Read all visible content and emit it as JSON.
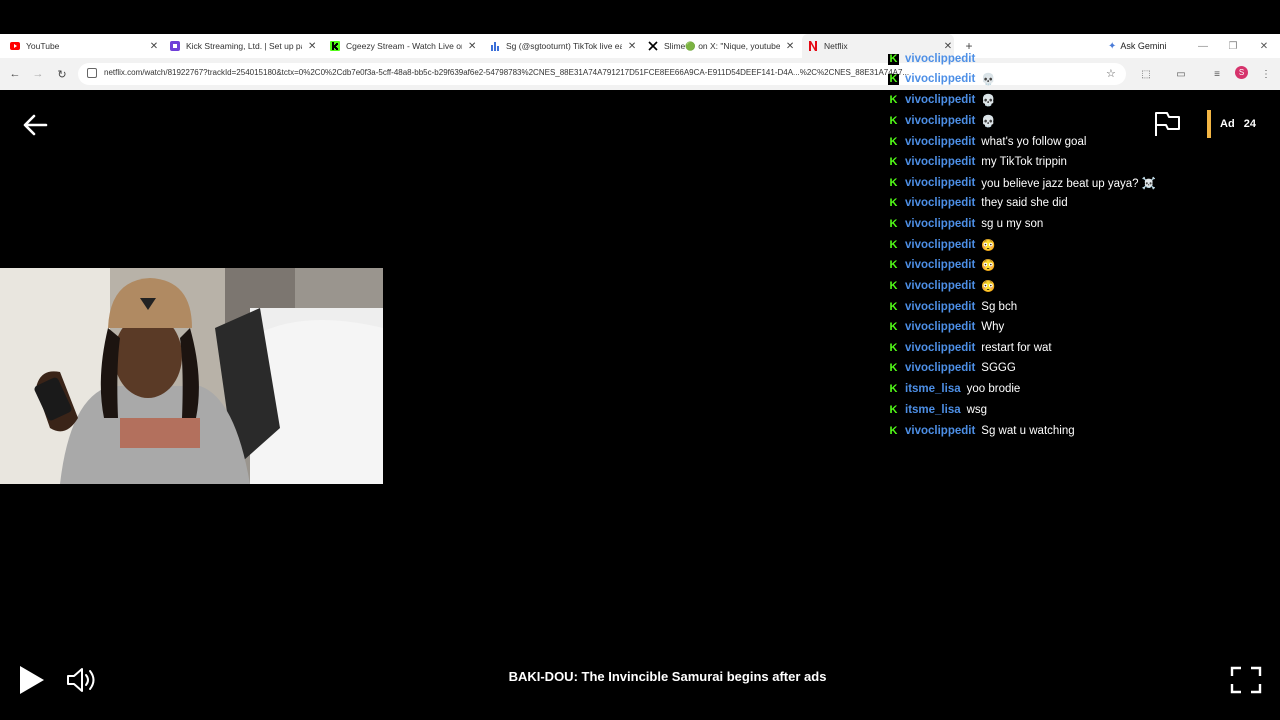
{
  "browser": {
    "tabs": [
      {
        "title": "YouTube",
        "icon": "youtube-icon",
        "color": "#ff0000"
      },
      {
        "title": "Kick Streaming, Ltd. | Set up pa",
        "icon": "kick-purple-icon",
        "color": "#6f3fd8"
      },
      {
        "title": "Cgeezy Stream - Watch Live on",
        "icon": "kick-icon",
        "color": "#53fc18"
      },
      {
        "title": "Sg (@sgtooturnt) TikTok live ea",
        "icon": "chart-icon",
        "color": "#3b6fd8"
      },
      {
        "title": "Slime🟢 on X: \"Nique, youtube",
        "icon": "x-icon",
        "color": "#000000"
      },
      {
        "title": "Netflix",
        "icon": "netflix-icon",
        "color": "#e50914"
      }
    ],
    "new_tab": "+",
    "gemini_label": "Ask Gemini",
    "url": "netflix.com/watch/81922767?trackId=254015180&tctx=0%2C0%2Cdb7e0f3a-5cff-48a8-bb5c-b29f639af6e2-54798783%2CNES_88E31A74A791217D51FCE8EE66A9CA-E911D54DEEF141-D4A...%2C%2CNES_88E31A74A7...",
    "profile_initial": "S"
  },
  "player": {
    "ad_label": "Ad",
    "ad_seconds": "24",
    "now_title": "BAKI-DOU: The Invincible Samurai begins after ads",
    "ad_color": "#f2b544"
  },
  "chat": {
    "username_color": "#4d8fe6",
    "badge_color": "#53fc18",
    "messages": [
      {
        "user": "vivoclippedit",
        "text": ""
      },
      {
        "user": "vivoclippedit",
        "text": "💀"
      },
      {
        "user": "vivoclippedit",
        "text": "💀"
      },
      {
        "user": "vivoclippedit",
        "text": "💀"
      },
      {
        "user": "vivoclippedit",
        "text": "what's yo follow goal"
      },
      {
        "user": "vivoclippedit",
        "text": "my TikTok trippin"
      },
      {
        "user": "vivoclippedit",
        "text": "you believe jazz beat up yaya? ☠️"
      },
      {
        "user": "vivoclippedit",
        "text": "they said she did"
      },
      {
        "user": "vivoclippedit",
        "text": "sg u my son"
      },
      {
        "user": "vivoclippedit",
        "text": "😳"
      },
      {
        "user": "vivoclippedit",
        "text": "😳"
      },
      {
        "user": "vivoclippedit",
        "text": "😳"
      },
      {
        "user": "vivoclippedit",
        "text": "Sg bch"
      },
      {
        "user": "vivoclippedit",
        "text": "Why"
      },
      {
        "user": "vivoclippedit",
        "text": "restart for wat"
      },
      {
        "user": "vivoclippedit",
        "text": "SGGG"
      },
      {
        "user": "itsme_lisa",
        "text": "yoo brodie"
      },
      {
        "user": "itsme_lisa",
        "text": "wsg"
      },
      {
        "user": "vivoclippedit",
        "text": "Sg wat u watching"
      }
    ]
  }
}
